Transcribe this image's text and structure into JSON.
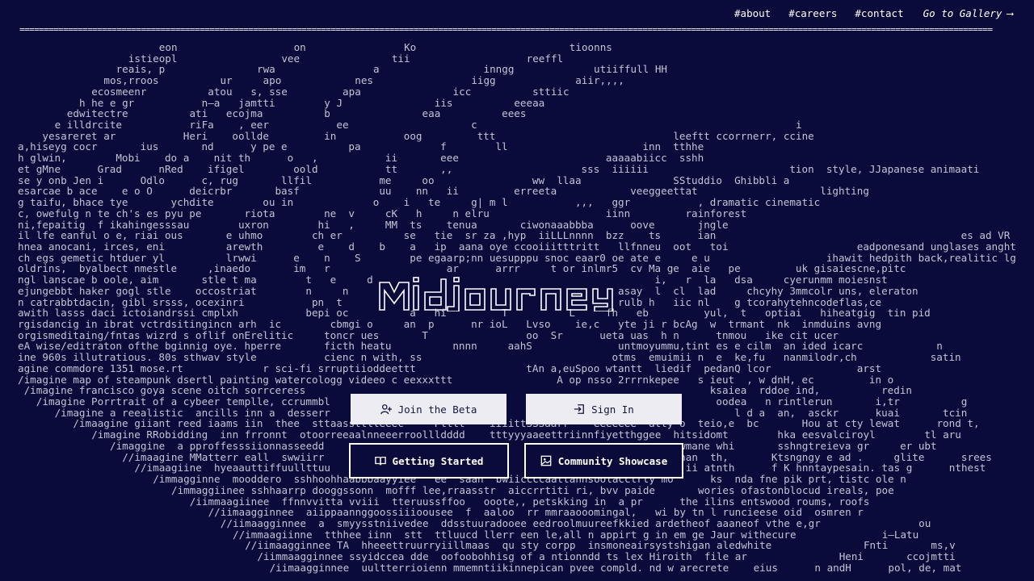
{
  "colors": {
    "background": "#0b0b3b",
    "text": "#ffffff",
    "ascii": "#c3c3d6",
    "button_light": "#ececf2"
  },
  "nav": {
    "about": "#about",
    "careers": "#careers",
    "contact": "#contact",
    "gallery": "Go to Gallery",
    "gallery_arrow": "⟶"
  },
  "divider": "========================================================================================================================================================================================================",
  "ascii_lines": [
    {
      "indent": 23,
      "text": "eon                   on                Ko                         tioonns"
    },
    {
      "indent": 18,
      "text": "istieopl                 vee               tii                   reeffl"
    },
    {
      "indent": 16,
      "text": "reais, p               rwa                a                 inngg             utiiffull HH"
    },
    {
      "indent": 14,
      "text": "mos,rroos          ur     apo            nes                iigg             aiir,,,,"
    },
    {
      "indent": 12,
      "text": "ecosmeenr          atou   s, sse         apa               icc          sttiic"
    },
    {
      "indent": 10,
      "text": "h he e gr           n–a   jamtti        y J               iis          eeeaa"
    },
    {
      "indent": 8,
      "text": "edwitectre          ati   ecojma          b               eaa          eees"
    },
    {
      "indent": 6,
      "text": "e illdrcite           riFa    , eer           ee                    c                                                    i"
    },
    {
      "indent": 4,
      "text": "yesareret ar           Heri    oollde         in           oog         ttt                             leeftt ccorrnerr, ccine"
    },
    {
      "indent": 0,
      "text": "a,hiseyg cocr       ius       nd      y pe e          pa             f        ll                      inn  tthhe"
    },
    {
      "indent": 0,
      "text": "h glwin,        Mobi    do a    nit th      o   ,           ii       eee                        aaaaabiicc  sshh"
    },
    {
      "indent": 0,
      "text": "et gMne      Grad      nRed    ifigel        oold           tt       ,,                     sss  iiiiii                       tion  style, JJapanese animaati"
    },
    {
      "indent": 0,
      "text": "se y onb Jen i      Odlo      c, rug       llfil           me     oo                ww  llaa               SStuddio  Ghibbli a"
    },
    {
      "indent": 0,
      "text": "esarcae b ace    e o O      deicrbr       basf             uu    nn   ii         erreeta            veeggeettat                    lighting"
    },
    {
      "indent": 0,
      "text": "g taifu, bhace tye       ychdite        ou in             o    i   te     g| m l           ,,,   ggr           , dramatic cinematic"
    },
    {
      "indent": 0,
      "text": "c, owefulg n te ch's es pyu pe       riota        ne  v     cK   h     n elru                   iinn         rainforest"
    },
    {
      "indent": 0,
      "text": "ni,fepaitig  f ikahingesssau        uxron        hi   ,     MM  ts    tenua       ciwonaaabbba      oove       jngle"
    },
    {
      "indent": 0,
      "text": "il lfe eanful o e, riai ous       e uhmo        ch er          se   tie  sr za ,hyp  iiLLLnnnn  bzz    ts      ian                                        es ad VR go"
    },
    {
      "indent": 0,
      "text": "hnea anocani, irces, eni          arewth         e    d    b    a   ip  aana oye ccooiiitttritt   llfnneu  oot   toi                     eadponesand unglases anghti"
    },
    {
      "indent": 0,
      "text": "ch egs gemetic htduer yl          lrwwi      e    n    S        pe egaarp;nn uesupppu snoc eaar0 oe ate e     e u                   ihawit hedpith back,realitic lgh"
    },
    {
      "indent": 0,
      "text": "oldrins,  byalbect nmestle     ,inaedo       im   r                   ar      arrr     t or inlmr5  cv Ma ge  aie   pe         uk gisaiescne,pitc"
    },
    {
      "indent": 0,
      "text": "ngl lanscae b oole, aim       stle t ma        t   e     d                                              i,   r  la   dsa     cyerunmm moiesnst"
    },
    {
      "indent": 0,
      "text": "ejungebbt haker gogl stle    occostriat        n     n                                            asay  l  cl  lad     chcyhy 3mmcolr uns, eleraton"
    },
    {
      "indent": 0,
      "text": "n catrabbtdacin, gibl srsss, ocexinri           pn  t                                             rulb h   iic nl    g tcorahytehncodeflas,ce"
    },
    {
      "indent": 0,
      "text": "awith lasss daci ictoiandrssi cmplxh           bepi oc          a   hi         T          L     fh   eb         yul,  t   optiai   hiheatgig  tin pid"
    },
    {
      "indent": 0,
      "text": "rgisdancig in ibrat vctrdsitingincn arh  ic        cbmgi o     an  p      nr ioL   Lvso    ie,c   yte ji r bcAg  w  trmant  nk  inmduins avng"
    },
    {
      "indent": 0,
      "text": "orgismeditaing/fntas wizrd s oflif onErelitic     toncr ues       T                oo  Sr      ueta uas  h n      tnmou   ike cit ucer"
    },
    {
      "indent": 0,
      "text": "eA wise/editraton ofthe bginnig oye. hperre       ficth heatu          nnnn     aahS              untmoyummu,tint es e cilm  an ided icarc            n"
    },
    {
      "indent": 0,
      "text": "ine 960s illutratious. 80s sthwav style           cienc n with, ss                               otms  emuimii n  e  ke,fu   nanmilodr,ch            satin"
    },
    {
      "indent": 0,
      "text": "agine commdore 1351 mose.rt             r sci-fi srruptiioddeettt                  tAn a,euSpoo wtantt  liedif  pedanQ lcor              arst"
    },
    {
      "indent": 0,
      "text": "/imagine map of steampunk dsertl painting watercologg videeo c eexxxttt                 A op nsso 2rrrnkepee   s ieut  , w dnH, ec         in o"
    },
    {
      "indent": 1,
      "text": "/imagine francisco goya scene oitch sorrceress                                                                  ksaiea  rddoe ind,          redin"
    },
    {
      "indent": 3,
      "text": "/imagine Porrtrait of a cybeer templle, ccrummbl                                                               oodea   n rintlerun       i,tr          g"
    },
    {
      "indent": 6,
      "text": "/imagine a reealistic  ancills inn a  desserr                                                                  l d a  an,  asckr      kuai       tcin          , l"
    },
    {
      "indent": 9,
      "text": "/imaagine giiant reed iaams iin  thee  sttaassttlleeec     Ptttt    iiiittSSSaarr    eeeeeee  atty o  teio,e  bc       Hou at cty lewat      rond t,"
    },
    {
      "indent": 12,
      "text": "/imagine RRobidding  inn frronnt  otoorreeaalnneeerroollldddd    tttyyyaaeettriinnfiyetthggee  hitsidomt        hka eesvalciroyl        tl aru"
    },
    {
      "indent": 15,
      "text": "/imaggine  a pproffesssiionnasseedd                                                          wmane whi       sshngtreieva gr     er ubt"
    },
    {
      "indent": 17,
      "text": "//imaagine MMatterr eall  swwiirr                                                         anan  th,       Ktsngngy e ad .     glite      srees"
    },
    {
      "indent": 19,
      "text": "//imaagiine  hyeaauttiffuullttuu                                                          ii atnth      f K hnntaypesain. tas g      nthest"
    },
    {
      "indent": 22,
      "text": "/immagginne  mooddero  sshhoohhaabbbaayyiee   ee  saan  bwiiccccaattannsoolacctrty mo      ks  nda fne pik prt, tistc ole n"
    },
    {
      "indent": 25,
      "text": "/immaggiinee sshhaarrp dooggssonn  mofff lee,rraasstr  aiccrrtiti ri, bvv paide       wories ofastonblocud ireals, poe"
    },
    {
      "indent": 28,
      "text": "/iimmaagiinee  ffnnvvitta vviii  tteruussffoo   ooote,, petskking in  a pr      the ilins entswood roums, roofs"
    },
    {
      "indent": 31,
      "text": "//iimaagginnee  aiippaannggoossiiioousee  f  aaloo  rr mmraaooomingal,   wi by tn l runcieese oid  osmren r"
    },
    {
      "indent": 33,
      "text": "//iimaagginnee  a  smyysstniivedee  ddsstuuradooee eedroolmuureefkkied ardetheof aaaneof vthe e,gr                ou"
    },
    {
      "indent": 35,
      "text": "//immaagiinne  tthhee iinn  stt  ttluucd llerr een le,all n appirt g in em ge Jaur withecure              i–Latu"
    },
    {
      "indent": 37,
      "text": "//iimaagginnee TA  hheeettruurryiillmaas  qu sty corpp  insmoneairsystshigan aledwhite               Fnti       ms,v"
    },
    {
      "indent": 39,
      "text": "/iimmaagginnee ssyidccea dde  oofoobohhisg of a ntionndd ts lex Hiroith  file ar               Heni       ccojmtti"
    },
    {
      "indent": 41,
      "text": "/iimaagginnee  uultterrioienn mmemntiikinnepican pvee compld. nd w arecrete    eius      n andH      pol, de, mat"
    }
  ],
  "buttons": {
    "join": "Join the Beta",
    "signin": "Sign In",
    "getting_started": "Getting Started",
    "showcase": "Community Showcase"
  },
  "icons": {
    "join": "user-plus-icon",
    "signin": "sign-in-icon",
    "getting_started": "book-open-icon",
    "showcase": "image-icon"
  }
}
